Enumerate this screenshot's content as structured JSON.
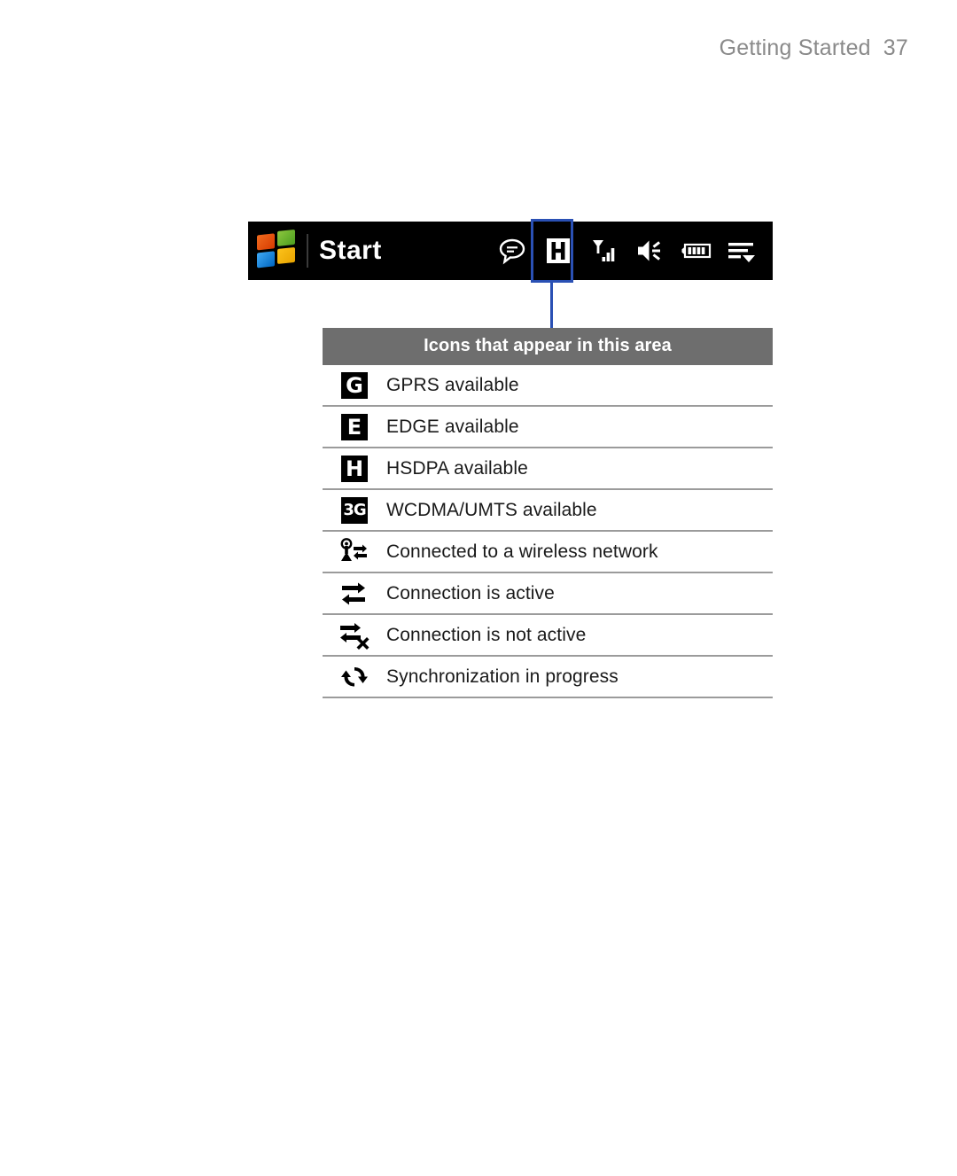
{
  "page": {
    "header_title": "Getting Started",
    "page_number": "37"
  },
  "statusbar": {
    "start_label": "Start",
    "logo": "windows-flag-logo",
    "icons": [
      {
        "name": "notification-bubble-icon",
        "label": "Notification"
      },
      {
        "name": "hsdpa-h-icon",
        "label": "H",
        "highlighted": true
      },
      {
        "name": "signal-strength-icon",
        "label": "Signal strength"
      },
      {
        "name": "volume-speaker-icon",
        "label": "Volume"
      },
      {
        "name": "battery-icon",
        "label": "Battery"
      },
      {
        "name": "menu-list-icon",
        "label": "Menu"
      }
    ]
  },
  "callout": {
    "highlight_color": "#2a50b4",
    "target_icon": "hsdpa-h-icon"
  },
  "icon_table": {
    "header": "Icons that appear in this area",
    "header_bg": "#6e6e6e",
    "rows": [
      {
        "icon": "gprs-tile-icon",
        "glyph": "G",
        "label": "GPRS available"
      },
      {
        "icon": "edge-tile-icon",
        "glyph": "E",
        "label": "EDGE available"
      },
      {
        "icon": "hsdpa-tile-icon",
        "glyph": "H",
        "label": "HSDPA available"
      },
      {
        "icon": "wcdma-umts-tile-icon",
        "glyph": "3G",
        "label": "WCDMA/UMTS available"
      },
      {
        "icon": "wireless-network-connected-icon",
        "glyph": "",
        "label": "Connected to a wireless network"
      },
      {
        "icon": "connection-active-icon",
        "glyph": "",
        "label": "Connection is active"
      },
      {
        "icon": "connection-inactive-icon",
        "glyph": "",
        "label": "Connection is not active"
      },
      {
        "icon": "synchronization-icon",
        "glyph": "",
        "label": "Synchronization in progress"
      }
    ]
  }
}
